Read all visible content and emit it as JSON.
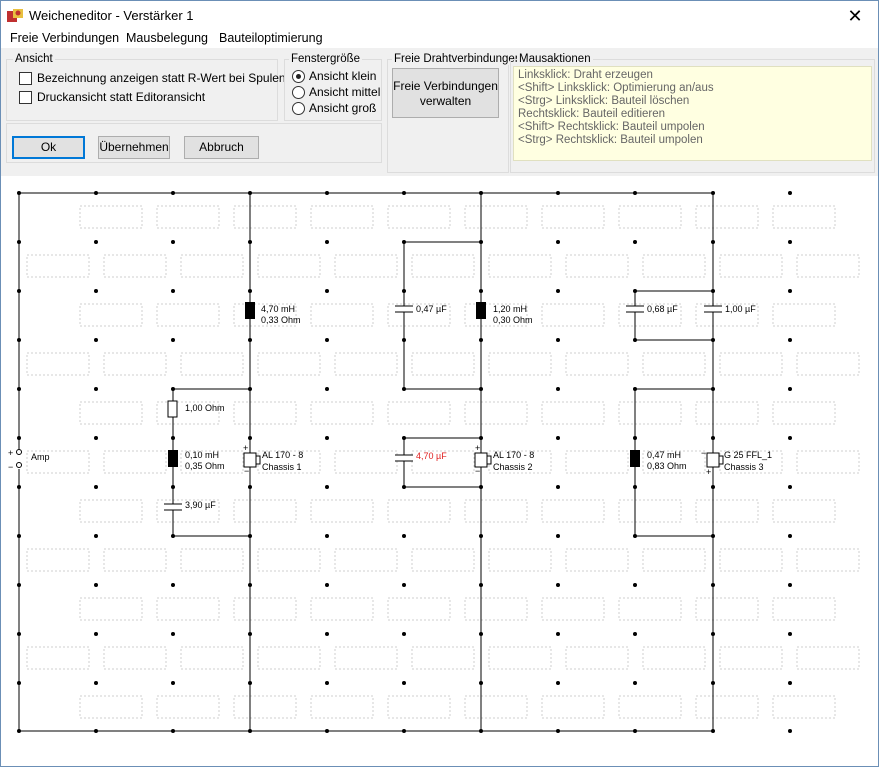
{
  "window": {
    "title": "Weicheneditor - Verstärker 1",
    "close_symbol": "✕"
  },
  "menu": [
    "Freie Verbindungen",
    "Mausbelegung",
    "Bauteiloptimierung"
  ],
  "ansicht": {
    "label": "Ansicht",
    "checkbox1": "Bezeichnung anzeigen statt R-Wert bei Spulen",
    "checkbox1_checked": false,
    "checkbox2": "Druckansicht statt Editoransicht",
    "checkbox2_checked": false
  },
  "fenster": {
    "label": "Fenstergröße",
    "options": [
      "Ansicht klein",
      "Ansicht mittel",
      "Ansicht groß"
    ],
    "selected": "Ansicht klein"
  },
  "draht": {
    "label": "Freie Drahtverbindungen",
    "button_line1": "Freie Verbindungen",
    "button_line2": "verwalten"
  },
  "maus": {
    "label": "Mausaktionen",
    "lines": [
      "Linksklick: Draht erzeugen",
      "<Shift> Linksklick: Optimierung an/aus",
      "<Strg> Linksklick: Bauteil löschen",
      "Rechtsklick: Bauteil editieren",
      "<Shift> Rechtsklick: Bauteil umpolen",
      "<Strg> Rechtsklick: Bauteil umpolen"
    ]
  },
  "buttons": {
    "ok": "Ok",
    "apply": "Übernehmen",
    "cancel": "Abbruch"
  },
  "schematic": {
    "amp": "Amp",
    "amp_plus": "+",
    "amp_minus": "−",
    "r1": "1,00 Ohm",
    "l1_value": "0,10 mH",
    "l1_res": "0,35 Ohm",
    "c1": "3,90 µF",
    "l2_value": "4,70 mH",
    "l2_res": "0,33 Ohm",
    "spk1_name": "AL 170 - 8",
    "spk1_chassis": "Chassis 1",
    "c2": "0,47 µF",
    "c3": "4,70 µF",
    "l3_value": "1,20 mH",
    "l3_res": "0,30 Ohm",
    "spk2_name": "AL 170 - 8",
    "spk2_chassis": "Chassis 2",
    "c4": "0,68 µF",
    "c5": "1,00 µF",
    "l4_value": "0,47 mH",
    "l4_res": "0,83 Ohm",
    "spk3_name": "G 25 FFL_1",
    "spk3_chassis": "Chassis 3",
    "polarity_plus": "+",
    "polarity_minus": "−"
  },
  "colors": {
    "highlight_value": "#e02020",
    "info_bg": "#ffffe1",
    "default_button": "#0078d7"
  }
}
